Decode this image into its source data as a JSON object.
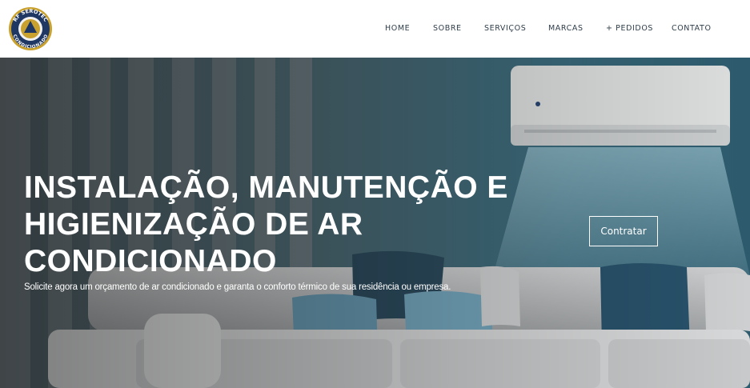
{
  "brand": {
    "logo_top_text": "RF SEROTEC",
    "logo_bottom_text": "CONDICIONADO"
  },
  "nav": {
    "items": [
      "HOME",
      "SOBRE",
      "SERVIÇOS",
      "MARCAS",
      "+ PEDIDOS",
      "CONTATO"
    ]
  },
  "hero": {
    "title_lines": [
      "INSTALAÇÃO, MANUTENÇÃO E",
      "HIGIENIZAÇÃO DE AR",
      "CONDICIONADO"
    ],
    "subtitle": "Solicite agora um orçamento de ar condicionado e garanta o conforto térmico de sua residência ou empresa.",
    "cta_label": "Contratar"
  },
  "colors": {
    "nav_text": "#2f3e4a",
    "wall_blue": "#3c6f82",
    "overlay": "#000000",
    "logo_navy": "#1f3763",
    "logo_gold": "#c9a12e"
  }
}
